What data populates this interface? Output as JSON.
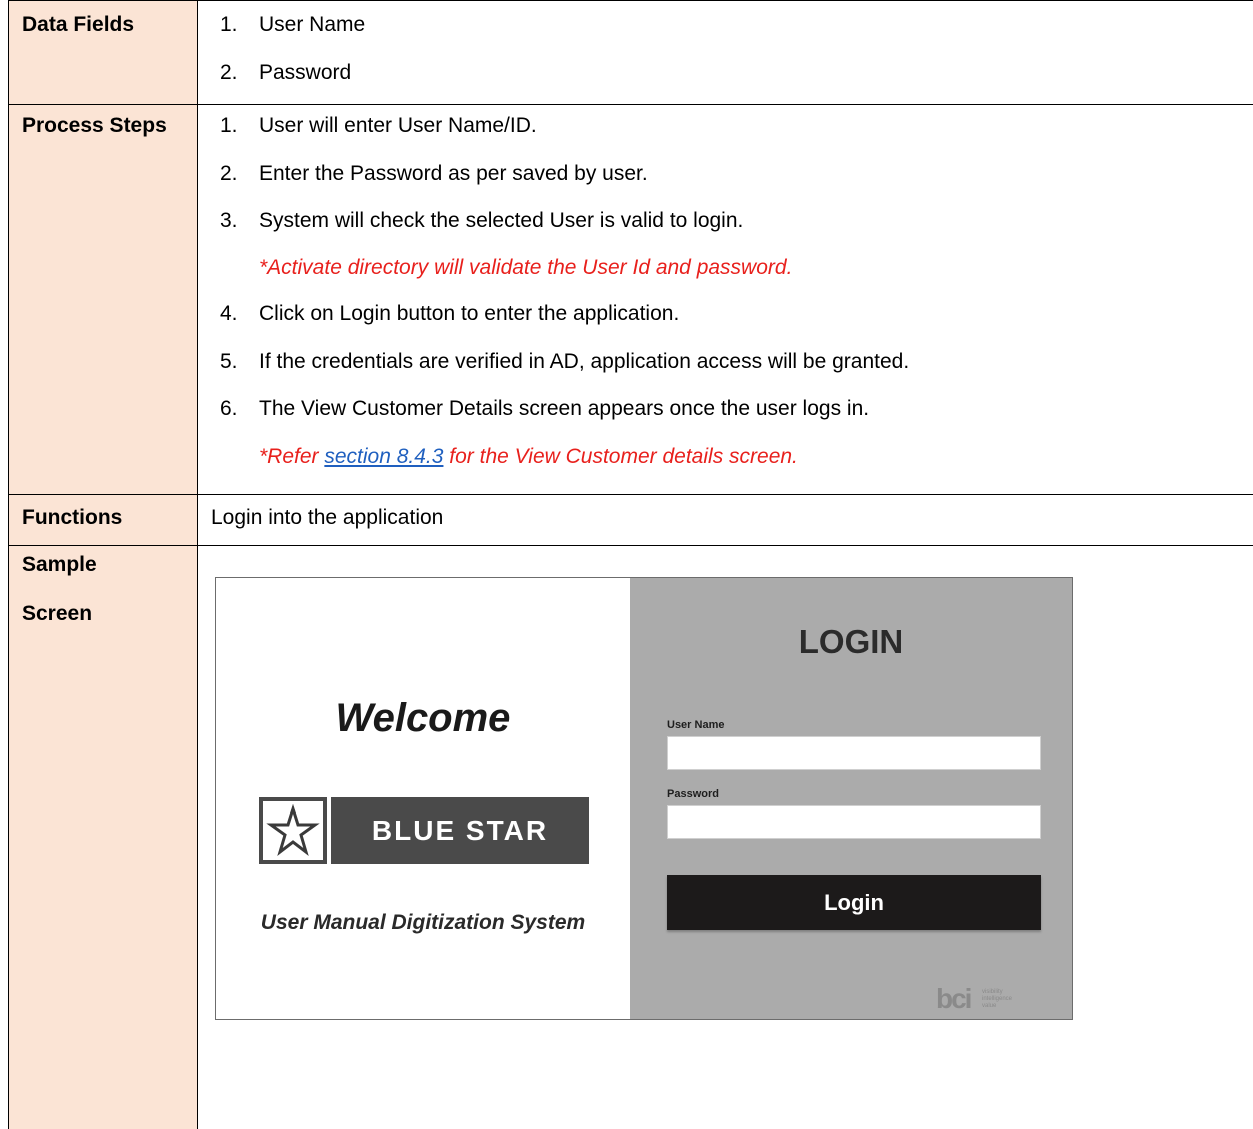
{
  "data_fields": {
    "label": "Data Fields",
    "items": [
      {
        "num": "1.",
        "text": "User Name"
      },
      {
        "num": "2.",
        "text": "Password"
      }
    ]
  },
  "process_steps": {
    "label": "Process Steps",
    "items": [
      {
        "num": "1.",
        "text": "User will enter User Name/ID."
      },
      {
        "num": "2.",
        "text": "Enter the Password as per saved by user."
      },
      {
        "num": "3.",
        "text": "System will check the selected User is valid to login."
      },
      {
        "num": "4.",
        "text": "Click on Login button to enter the application."
      },
      {
        "num": "5.",
        "text": "If the credentials are verified in AD, application access will be granted."
      },
      {
        "num": "6.",
        "text": "The View Customer Details screen appears once the user logs in."
      }
    ],
    "note_ad": "*Activate directory will validate the User Id and password.",
    "note_refer_prefix": "*Refer ",
    "note_refer_link": "section 8.4.3",
    "note_refer_suffix": " for the View Customer details screen."
  },
  "functions": {
    "label": "Functions",
    "text": "Login into the application"
  },
  "sample_screen": {
    "label_line1": "Sample",
    "label_line2": "Screen",
    "welcome": "Welcome",
    "brand_name": "BLUE STAR",
    "subtitle": "User Manual Digitization System",
    "login_title": "LOGIN",
    "username_label": "User Name",
    "password_label": "Password",
    "username_value": "",
    "password_value": "",
    "login_button": "Login",
    "bci_mark": "bci",
    "bci_tagline": [
      "visibility",
      "intelligence",
      "value"
    ]
  },
  "colors": {
    "label_bg": "#fbe4d5",
    "note_red": "#e8201c",
    "link_blue": "#1f5fbf",
    "right_panel": "#ababab",
    "login_button_bg": "#1c1a1a"
  }
}
